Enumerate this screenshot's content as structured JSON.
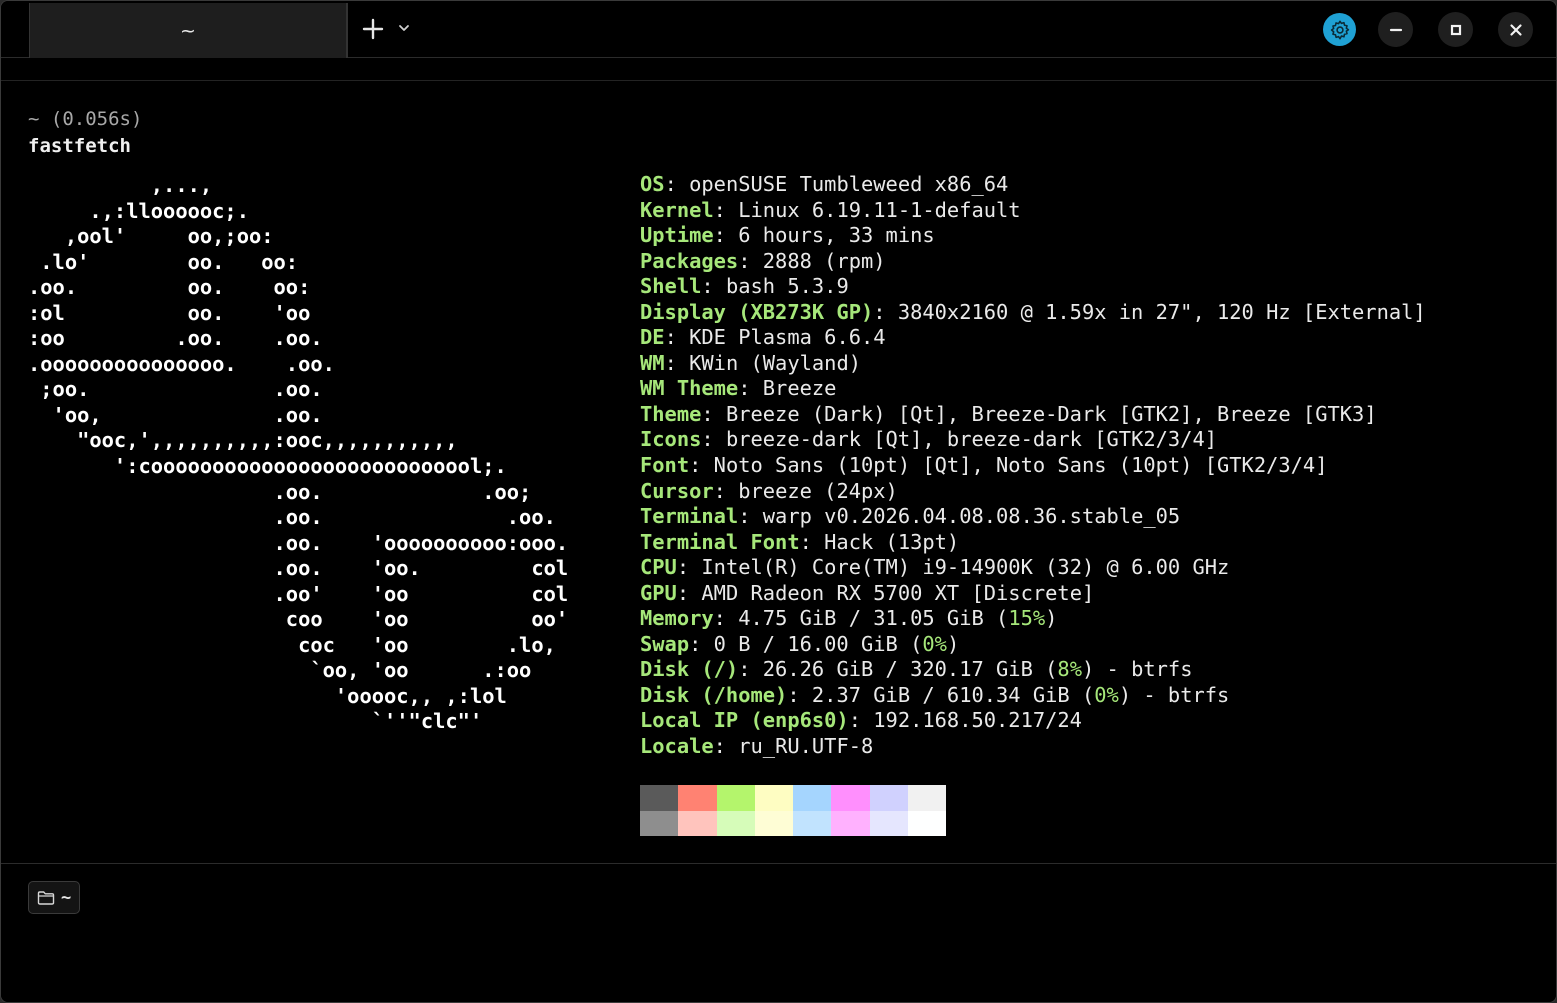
{
  "tab": {
    "title": "~"
  },
  "titlebar": {
    "buttons": [
      "new-tab",
      "tab-menu",
      "settings",
      "minimize",
      "maximize",
      "close"
    ],
    "settings_color": "#1fa1d4"
  },
  "block": {
    "context": "~ (0.056s)",
    "command": "fastfetch"
  },
  "logo_lines": [
    "          ,...,",
    "     .,:lloooooc;.",
    "   ,ool'     oo,;oo:",
    " .lo'        oo.   oo:",
    ".oo.         oo.    oo:",
    ":ol          oo.    'oo",
    ":oo         .oo.    .oo.",
    ".ooooooooooooooo.    .oo.",
    " ;oo.               .oo.",
    "  'oo,              .oo.",
    "    \"ooc,',,,,,,,,,,:ooc,,,,,,,,,,,",
    "       ':cooooooooooooooooooooooooool;.",
    "                    .oo.             .oo;",
    "                    .oo.               .oo.",
    "                    .oo.    'oooooooooo:ooo.",
    "                    .oo.    'oo.         col",
    "                    .oo'    'oo          col",
    "                     coo    'oo          oo'",
    "                      coc   'oo        .lo,",
    "                       `oo, 'oo      .:oo",
    "                         'ooooc,, ,:lol",
    "                            `''\"clc\"'"
  ],
  "info": [
    {
      "key": "OS",
      "value": "openSUSE Tumbleweed x86_64"
    },
    {
      "key": "Kernel",
      "value": "Linux 6.19.11-1-default"
    },
    {
      "key": "Uptime",
      "value": "6 hours, 33 mins"
    },
    {
      "key": "Packages",
      "value": "2888 (rpm)"
    },
    {
      "key": "Shell",
      "value": "bash 5.3.9"
    },
    {
      "key": "Display (XB273K GP)",
      "value": "3840x2160 @ 1.59x in 27\", 120 Hz [External]"
    },
    {
      "key": "DE",
      "value": "KDE Plasma 6.6.4"
    },
    {
      "key": "WM",
      "value": "KWin (Wayland)"
    },
    {
      "key": "WM Theme",
      "value": "Breeze"
    },
    {
      "key": "Theme",
      "value": "Breeze (Dark) [Qt], Breeze-Dark [GTK2], Breeze [GTK3]"
    },
    {
      "key": "Icons",
      "value": "breeze-dark [Qt], breeze-dark [GTK2/3/4]"
    },
    {
      "key": "Font",
      "value": "Noto Sans (10pt) [Qt], Noto Sans (10pt) [GTK2/3/4]"
    },
    {
      "key": "Cursor",
      "value": "breeze (24px)"
    },
    {
      "key": "Terminal",
      "value": "warp v0.2026.04.08.08.36.stable_05"
    },
    {
      "key": "Terminal Font",
      "value": "Hack (13pt)"
    },
    {
      "key": "CPU",
      "value": "Intel(R) Core(TM) i9-14900K (32) @ 6.00 GHz"
    },
    {
      "key": "GPU",
      "value": "AMD Radeon RX 5700 XT [Discrete]"
    },
    {
      "key": "Memory",
      "value": "4.75 GiB / 31.05 GiB (",
      "pct": "15%",
      "suffix": ")"
    },
    {
      "key": "Swap",
      "value": "0 B / 16.00 GiB (",
      "pct": "0%",
      "suffix": ")"
    },
    {
      "key": "Disk (/)",
      "value": "26.26 GiB / 320.17 GiB (",
      "pct": "8%",
      "suffix": ") - btrfs"
    },
    {
      "key": "Disk (/home)",
      "value": "2.37 GiB / 610.34 GiB (",
      "pct": "0%",
      "suffix": ") - btrfs"
    },
    {
      "key": "Local IP (enp6s0)",
      "value": "192.168.50.217/24"
    },
    {
      "key": "Locale",
      "value": "ru_RU.UTF-8"
    }
  ],
  "palette": {
    "row1": [
      "#5a5a5a",
      "#ff8272",
      "#b4f56c",
      "#fefdc2",
      "#a5d5fe",
      "#ff8ffd",
      "#d0d1fe",
      "#f1f1f1"
    ],
    "row2": [
      "#8e8e8e",
      "#ffc4bd",
      "#d6fcb9",
      "#fefdd5",
      "#c1e3fe",
      "#ffb1fe",
      "#e5e6fe",
      "#feffff"
    ]
  },
  "input": {
    "directory": "~"
  }
}
